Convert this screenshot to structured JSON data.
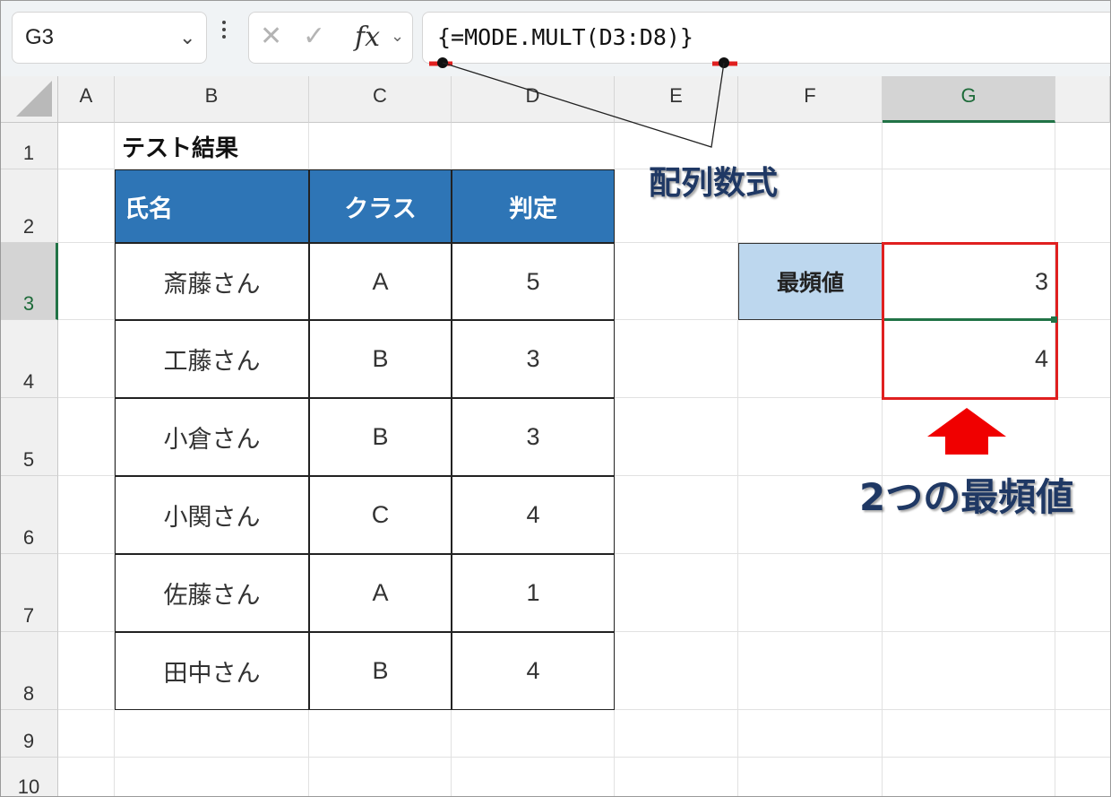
{
  "formula_bar": {
    "name_box": "G3",
    "name_box_arrow": "⌄",
    "cancel_glyph": "✕",
    "enter_glyph": "✓",
    "fx_label": "fx",
    "fx_arrow": "⌄",
    "formula": "{=MODE.MULT(D3:D8)}"
  },
  "columns": [
    "A",
    "B",
    "C",
    "D",
    "E",
    "F",
    "G"
  ],
  "selected_column": "G",
  "rows": [
    "1",
    "2",
    "3",
    "4",
    "5",
    "6",
    "7",
    "8",
    "9",
    "10"
  ],
  "selected_row": "3",
  "sheet": {
    "title": "テスト結果",
    "table_headers": [
      "氏名",
      "クラス",
      "判定"
    ],
    "table_rows": [
      [
        "斎藤さん",
        "A",
        "5"
      ],
      [
        "工藤さん",
        "B",
        "3"
      ],
      [
        "小倉さん",
        "B",
        "3"
      ],
      [
        "小関さん",
        "C",
        "4"
      ],
      [
        "佐藤さん",
        "A",
        "1"
      ],
      [
        "田中さん",
        "B",
        "4"
      ]
    ],
    "mode_label": "最頻値",
    "mode_values": [
      "3",
      "4"
    ]
  },
  "annotations": {
    "array_formula": "配列数式",
    "two_modes": "2つの最頻値"
  },
  "colors": {
    "header_fill": "#2e75b6",
    "label_fill": "#bdd7ee",
    "highlight_red": "#e02020",
    "excel_green": "#217346",
    "annotation_text": "#1f3864"
  }
}
